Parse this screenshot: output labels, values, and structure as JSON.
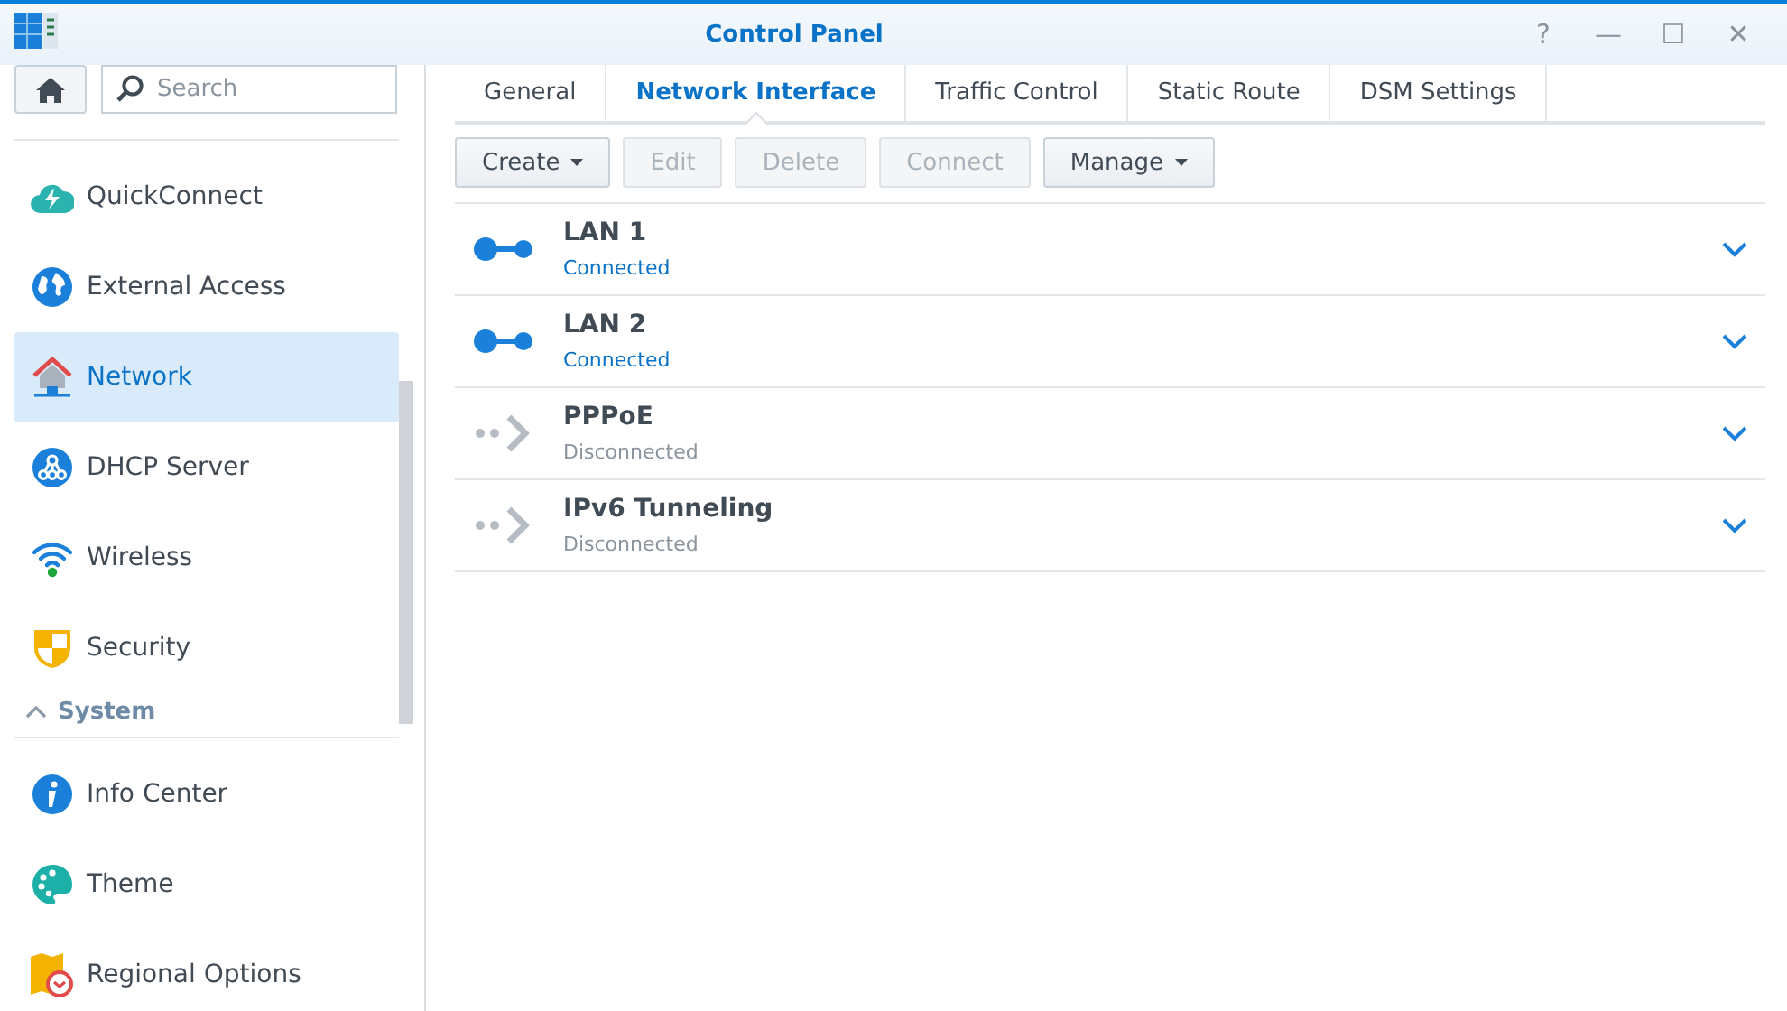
{
  "window": {
    "title": "Control Panel",
    "controls": [
      "?",
      "—",
      "☐",
      "✕"
    ]
  },
  "sidebar": {
    "search": {
      "placeholder": "Search"
    },
    "sections": [
      {
        "items": [
          {
            "label": "QuickConnect",
            "selected": false
          },
          {
            "label": "External Access",
            "selected": false
          },
          {
            "label": "Network",
            "selected": true
          },
          {
            "label": "DHCP Server",
            "selected": false
          },
          {
            "label": "Wireless",
            "selected": false
          },
          {
            "label": "Security",
            "selected": false
          }
        ]
      },
      {
        "title": "System",
        "expanded": true,
        "items": [
          {
            "label": "Info Center",
            "selected": false
          },
          {
            "label": "Theme",
            "selected": false
          },
          {
            "label": "Regional Options",
            "selected": false
          }
        ]
      }
    ]
  },
  "tabs": [
    {
      "label": "General",
      "selected": false
    },
    {
      "label": "Network Interface",
      "selected": true
    },
    {
      "label": "Traffic Control",
      "selected": false
    },
    {
      "label": "Static Route",
      "selected": false
    },
    {
      "label": "DSM Settings",
      "selected": false
    }
  ],
  "toolbar": [
    {
      "label": "Create",
      "dropdown": true,
      "disabled": false
    },
    {
      "label": "Edit",
      "dropdown": false,
      "disabled": true
    },
    {
      "label": "Delete",
      "dropdown": false,
      "disabled": true
    },
    {
      "label": "Connect",
      "dropdown": false,
      "disabled": true
    },
    {
      "label": "Manage",
      "dropdown": true,
      "disabled": false
    }
  ],
  "interfaces": [
    {
      "name": "LAN 1",
      "status": "Connected",
      "connected": true,
      "expanded": false
    },
    {
      "name": "LAN 2",
      "status": "Connected",
      "connected": true,
      "expanded": false
    },
    {
      "name": "PPPoE",
      "status": "Disconnected",
      "connected": false,
      "expanded": false
    },
    {
      "name": "IPv6 Tunneling",
      "status": "Disconnected",
      "connected": false,
      "expanded": false
    }
  ]
}
